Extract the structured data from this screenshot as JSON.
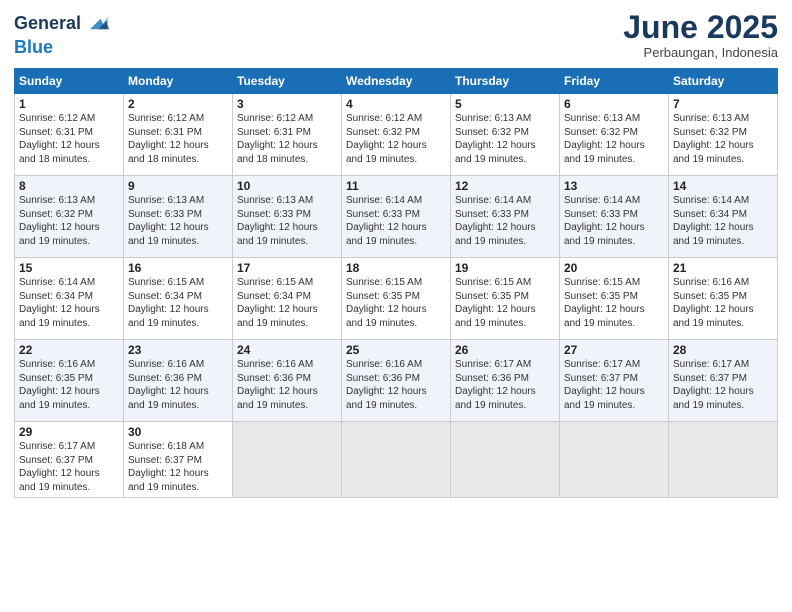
{
  "header": {
    "logo_line1": "General",
    "logo_line2": "Blue",
    "month": "June 2025",
    "location": "Perbaungan, Indonesia"
  },
  "weekdays": [
    "Sunday",
    "Monday",
    "Tuesday",
    "Wednesday",
    "Thursday",
    "Friday",
    "Saturday"
  ],
  "weeks": [
    [
      {
        "day": "1",
        "sunrise": "6:12 AM",
        "sunset": "6:31 PM",
        "daylight": "12 hours and 18 minutes."
      },
      {
        "day": "2",
        "sunrise": "6:12 AM",
        "sunset": "6:31 PM",
        "daylight": "12 hours and 18 minutes."
      },
      {
        "day": "3",
        "sunrise": "6:12 AM",
        "sunset": "6:31 PM",
        "daylight": "12 hours and 18 minutes."
      },
      {
        "day": "4",
        "sunrise": "6:12 AM",
        "sunset": "6:32 PM",
        "daylight": "12 hours and 19 minutes."
      },
      {
        "day": "5",
        "sunrise": "6:13 AM",
        "sunset": "6:32 PM",
        "daylight": "12 hours and 19 minutes."
      },
      {
        "day": "6",
        "sunrise": "6:13 AM",
        "sunset": "6:32 PM",
        "daylight": "12 hours and 19 minutes."
      },
      {
        "day": "7",
        "sunrise": "6:13 AM",
        "sunset": "6:32 PM",
        "daylight": "12 hours and 19 minutes."
      }
    ],
    [
      {
        "day": "8",
        "sunrise": "6:13 AM",
        "sunset": "6:32 PM",
        "daylight": "12 hours and 19 minutes."
      },
      {
        "day": "9",
        "sunrise": "6:13 AM",
        "sunset": "6:33 PM",
        "daylight": "12 hours and 19 minutes."
      },
      {
        "day": "10",
        "sunrise": "6:13 AM",
        "sunset": "6:33 PM",
        "daylight": "12 hours and 19 minutes."
      },
      {
        "day": "11",
        "sunrise": "6:14 AM",
        "sunset": "6:33 PM",
        "daylight": "12 hours and 19 minutes."
      },
      {
        "day": "12",
        "sunrise": "6:14 AM",
        "sunset": "6:33 PM",
        "daylight": "12 hours and 19 minutes."
      },
      {
        "day": "13",
        "sunrise": "6:14 AM",
        "sunset": "6:33 PM",
        "daylight": "12 hours and 19 minutes."
      },
      {
        "day": "14",
        "sunrise": "6:14 AM",
        "sunset": "6:34 PM",
        "daylight": "12 hours and 19 minutes."
      }
    ],
    [
      {
        "day": "15",
        "sunrise": "6:14 AM",
        "sunset": "6:34 PM",
        "daylight": "12 hours and 19 minutes."
      },
      {
        "day": "16",
        "sunrise": "6:15 AM",
        "sunset": "6:34 PM",
        "daylight": "12 hours and 19 minutes."
      },
      {
        "day": "17",
        "sunrise": "6:15 AM",
        "sunset": "6:34 PM",
        "daylight": "12 hours and 19 minutes."
      },
      {
        "day": "18",
        "sunrise": "6:15 AM",
        "sunset": "6:35 PM",
        "daylight": "12 hours and 19 minutes."
      },
      {
        "day": "19",
        "sunrise": "6:15 AM",
        "sunset": "6:35 PM",
        "daylight": "12 hours and 19 minutes."
      },
      {
        "day": "20",
        "sunrise": "6:15 AM",
        "sunset": "6:35 PM",
        "daylight": "12 hours and 19 minutes."
      },
      {
        "day": "21",
        "sunrise": "6:16 AM",
        "sunset": "6:35 PM",
        "daylight": "12 hours and 19 minutes."
      }
    ],
    [
      {
        "day": "22",
        "sunrise": "6:16 AM",
        "sunset": "6:35 PM",
        "daylight": "12 hours and 19 minutes."
      },
      {
        "day": "23",
        "sunrise": "6:16 AM",
        "sunset": "6:36 PM",
        "daylight": "12 hours and 19 minutes."
      },
      {
        "day": "24",
        "sunrise": "6:16 AM",
        "sunset": "6:36 PM",
        "daylight": "12 hours and 19 minutes."
      },
      {
        "day": "25",
        "sunrise": "6:16 AM",
        "sunset": "6:36 PM",
        "daylight": "12 hours and 19 minutes."
      },
      {
        "day": "26",
        "sunrise": "6:17 AM",
        "sunset": "6:36 PM",
        "daylight": "12 hours and 19 minutes."
      },
      {
        "day": "27",
        "sunrise": "6:17 AM",
        "sunset": "6:37 PM",
        "daylight": "12 hours and 19 minutes."
      },
      {
        "day": "28",
        "sunrise": "6:17 AM",
        "sunset": "6:37 PM",
        "daylight": "12 hours and 19 minutes."
      }
    ],
    [
      {
        "day": "29",
        "sunrise": "6:17 AM",
        "sunset": "6:37 PM",
        "daylight": "12 hours and 19 minutes."
      },
      {
        "day": "30",
        "sunrise": "6:18 AM",
        "sunset": "6:37 PM",
        "daylight": "12 hours and 19 minutes."
      },
      null,
      null,
      null,
      null,
      null
    ]
  ]
}
